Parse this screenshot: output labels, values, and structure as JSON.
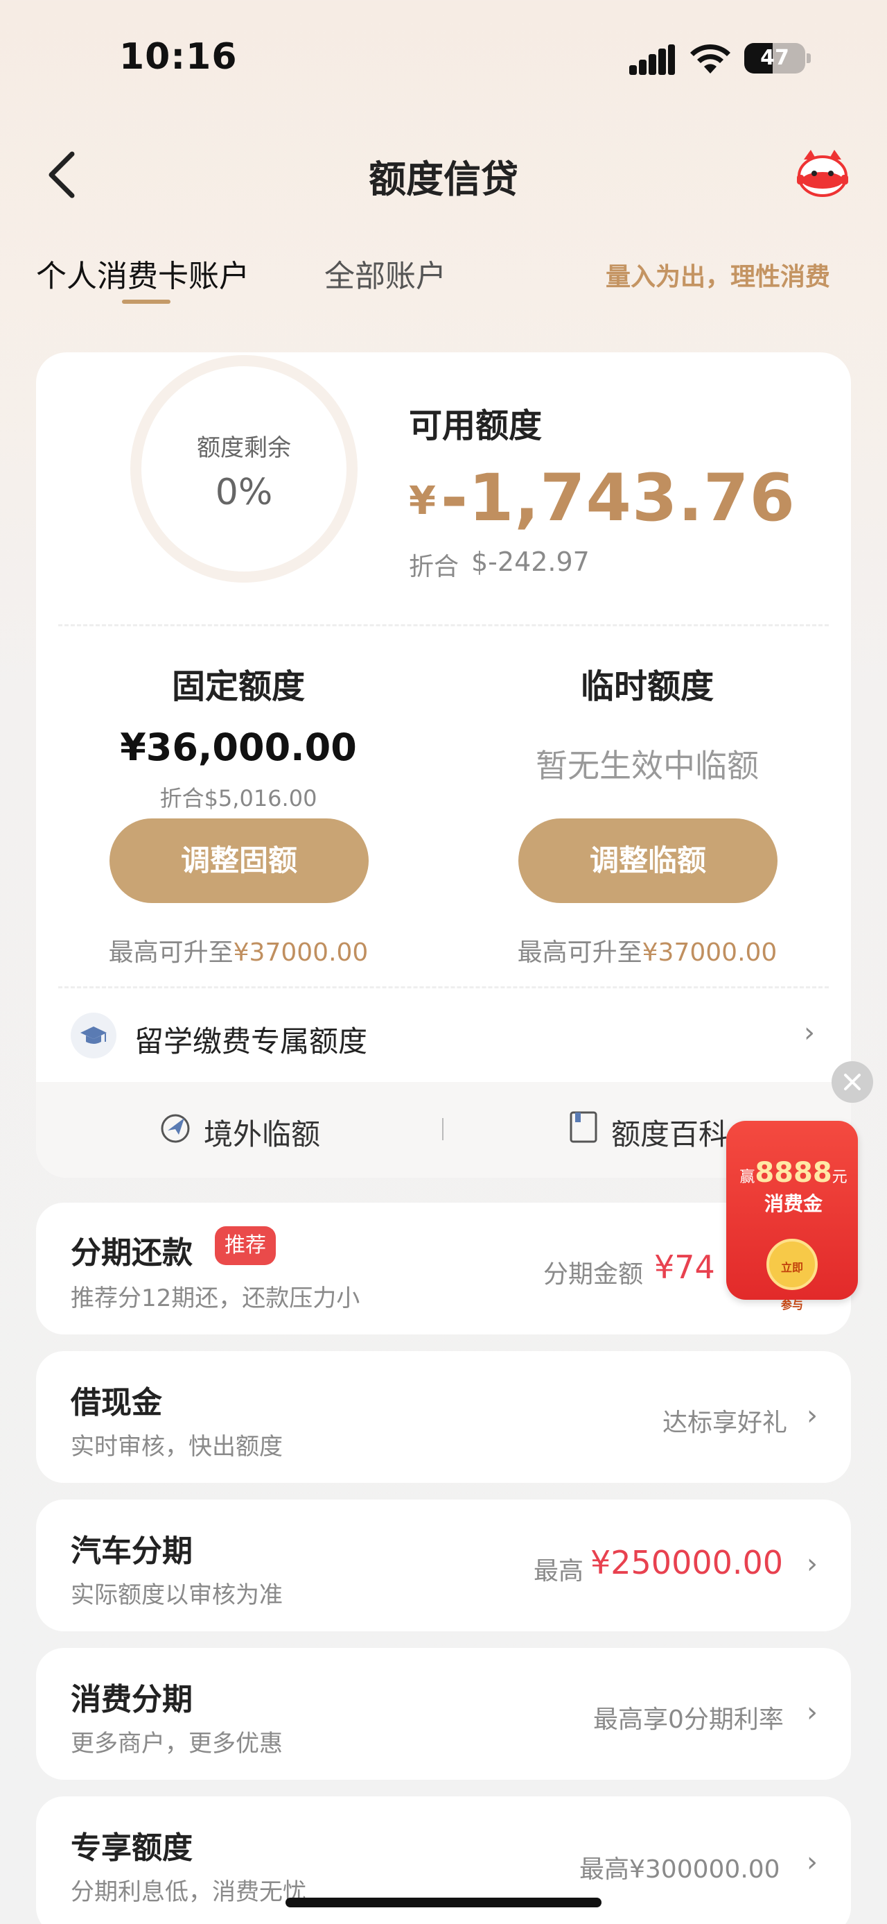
{
  "status": {
    "time": "10:16",
    "battery": "47",
    "battery_level": 0.47
  },
  "nav": {
    "title": "额度信贷",
    "back_icon": "chevron-left-icon",
    "mascot_icon": "mascot-icon"
  },
  "tabs": [
    {
      "label": "个人消费卡账户",
      "active": true
    },
    {
      "label": "全部账户",
      "active": false
    }
  ],
  "slogan": "量入为出，理性消费",
  "summary": {
    "ring_label": "额度剩余",
    "ring_value": "0%",
    "available_label": "可用额度",
    "available_currency": "¥",
    "available_value": "-1,743.76",
    "usd_label": "折合",
    "usd_value": "$-242.97"
  },
  "fixed": {
    "title": "固定额度",
    "value": "¥36,000.00",
    "usd": "折合$5,016.00",
    "button": "调整固额",
    "max_prefix": "最高可升至",
    "max_amount": "¥37000.00"
  },
  "temporary": {
    "title": "临时额度",
    "none_text": "暂无生效中临额",
    "button": "调整临额",
    "max_prefix": "最高可升至",
    "max_amount": "¥37000.00"
  },
  "education": {
    "label": "留学缴费专属额度",
    "icon": "graduation-cap-icon"
  },
  "quick_links": [
    {
      "label": "境外临额",
      "icon": "globe-plane-icon"
    },
    {
      "label": "额度百科",
      "icon": "book-icon"
    }
  ],
  "list": [
    {
      "title": "分期还款",
      "badge": "推荐",
      "subtitle": "推荐分12期还，还款压力小",
      "right_label": "分期金额",
      "right_amount": "¥74"
    },
    {
      "title": "借现金",
      "subtitle": "实时审核，快出额度",
      "right_label": "达标享好礼"
    },
    {
      "title": "汽车分期",
      "subtitle": "实际额度以审核为准",
      "right_label": "最高",
      "right_amount": "¥250000.00"
    },
    {
      "title": "消费分期",
      "subtitle": "更多商户，更多优惠",
      "right_label": "最高享0分期利率"
    },
    {
      "title": "专享额度",
      "subtitle": "分期利息低，消费无忧",
      "right_label": "最高¥300000.00"
    }
  ],
  "promo": {
    "prefix": "赢",
    "amount": "8888",
    "unit": "元",
    "line2": "消费金",
    "cta_line1": "立即",
    "cta_line2": "参与"
  },
  "colors": {
    "accent_gold": "#c08f5f",
    "button_gold": "#c9a474",
    "red": "#e8414f"
  }
}
